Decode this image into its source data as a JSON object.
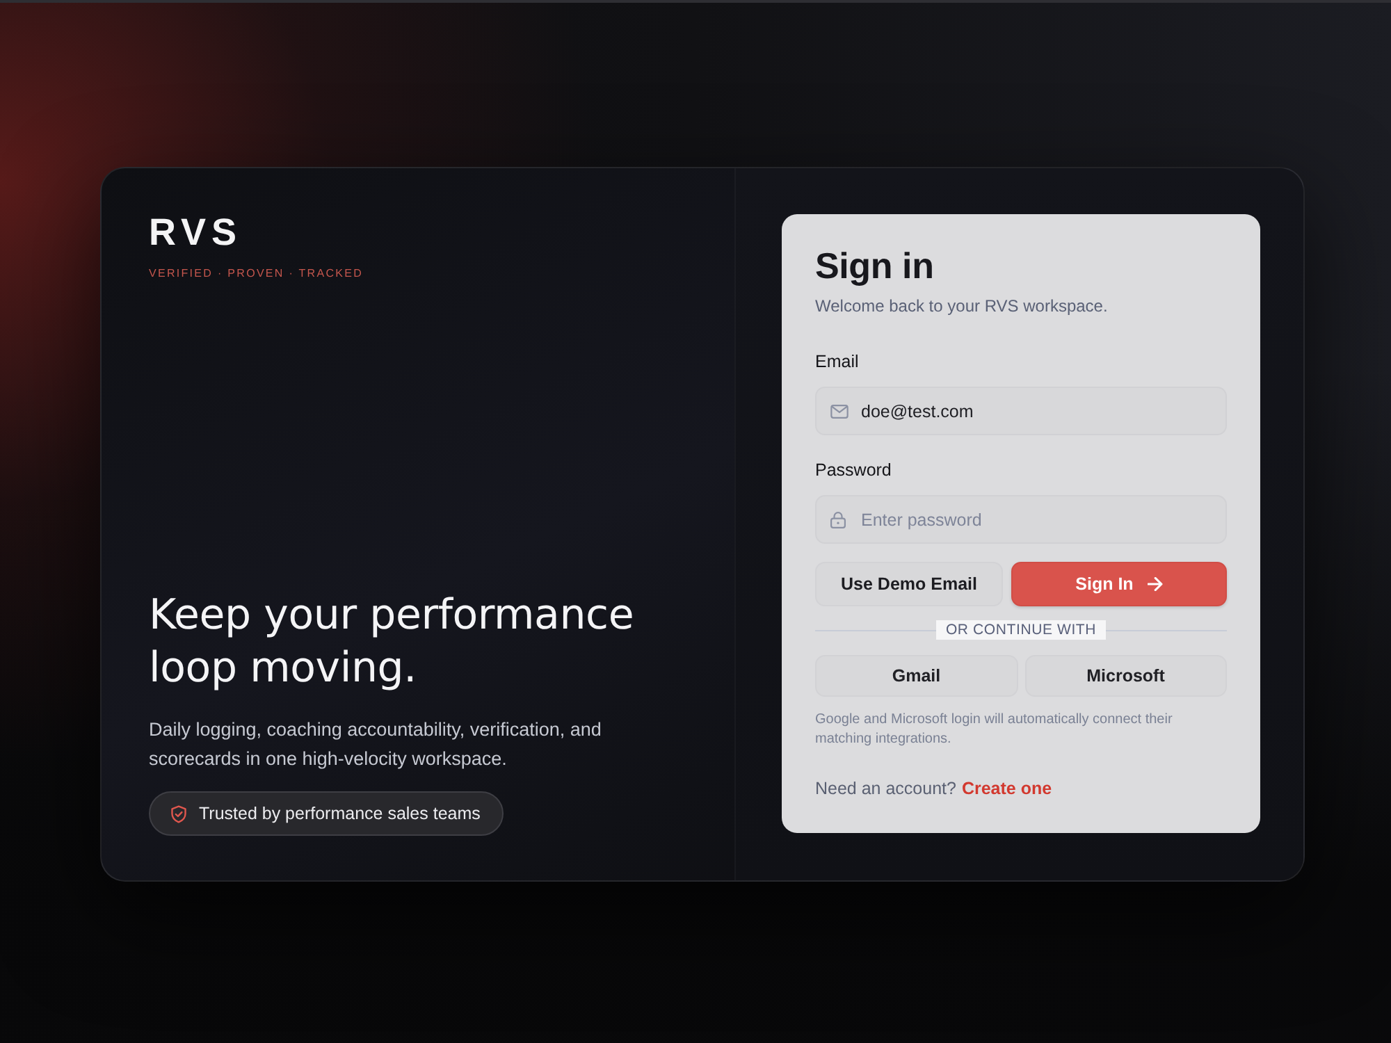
{
  "brand": {
    "logo": "RVS",
    "tagline": "VERIFIED · PROVEN · TRACKED"
  },
  "hero": {
    "headline": "Keep your performance loop moving.",
    "description": "Daily logging, coaching accountability, verification, and scorecards in one high-velocity workspace.",
    "badge": "Trusted by performance sales teams"
  },
  "signin": {
    "title": "Sign in",
    "subtitle": "Welcome back to your RVS workspace.",
    "fields": [
      {
        "kind": "email",
        "label": "Email",
        "value": "doe@test.com"
      },
      {
        "kind": "password",
        "label": "Password",
        "placeholder": "Enter password"
      }
    ],
    "buttons": [
      {
        "kind": "secondary",
        "label": "Use Demo Email"
      },
      {
        "kind": "primary",
        "label": "Sign In"
      }
    ],
    "divider": "OR CONTINUE WITH",
    "providers": [
      "Gmail",
      "Microsoft"
    ],
    "note": "Google and Microsoft login will automatically connect their matching integrations.",
    "footer": {
      "text": "Need an account?",
      "link": "Create one"
    }
  }
}
